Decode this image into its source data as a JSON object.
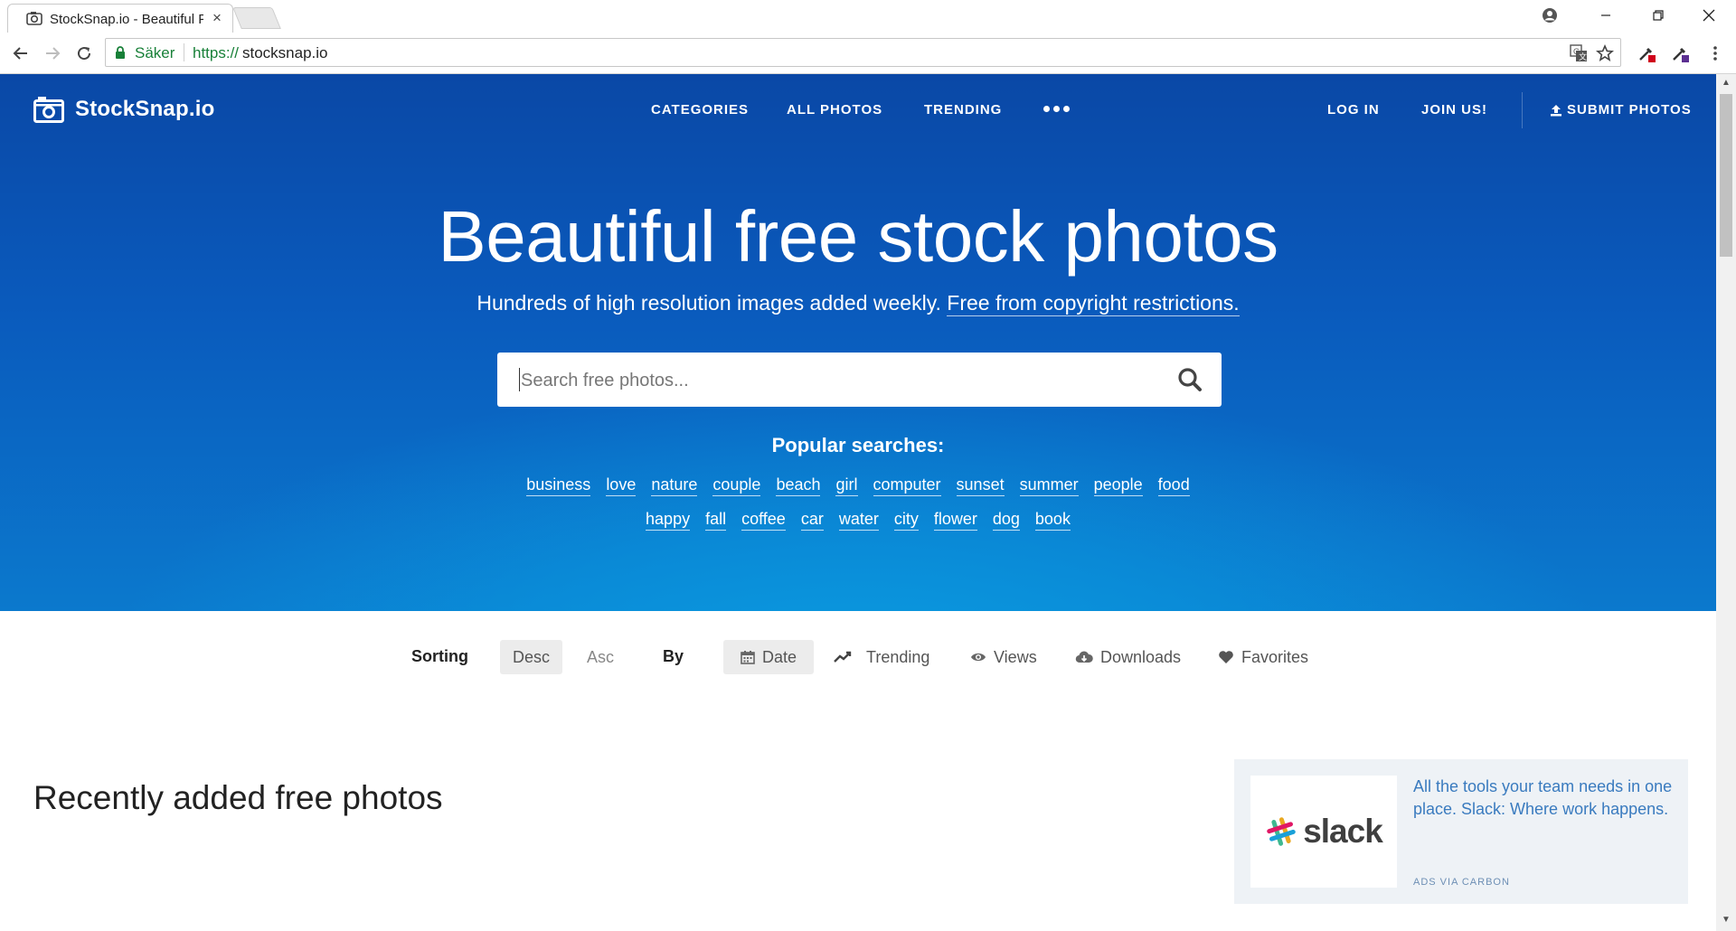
{
  "browser": {
    "tab_title": "StockSnap.io - Beautiful Free Stock Photos",
    "tab_close": "×",
    "secure_label": "Säker",
    "url_scheme": "https://",
    "url_host": "stocksnap.io"
  },
  "site": {
    "logo_text": "StockSnap.io",
    "nav": {
      "categories": "CATEGORIES",
      "all_photos": "ALL PHOTOS",
      "trending": "TRENDING",
      "log_in": "LOG IN",
      "join_us": "JOIN US!",
      "submit_photos": "SUBMIT PHOTOS"
    },
    "hero": {
      "title": "Beautiful free stock photos",
      "subtitle": "Hundreds of high resolution images added weekly.",
      "subtitle_link": "Free from copyright restrictions.",
      "search_placeholder": "Search free photos...",
      "popular_title": "Popular searches:",
      "popular_row1": [
        "business",
        "love",
        "nature",
        "couple",
        "beach",
        "girl",
        "computer",
        "sunset",
        "summer",
        "people",
        "food"
      ],
      "popular_row2": [
        "happy",
        "fall",
        "coffee",
        "car",
        "water",
        "city",
        "flower",
        "dog",
        "book"
      ]
    },
    "sorting": {
      "label": "Sorting",
      "desc": "Desc",
      "asc": "Asc",
      "by_label": "By",
      "date": "Date",
      "trending": "Trending",
      "views": "Views",
      "downloads": "Downloads",
      "favorites": "Favorites"
    },
    "recent_title": "Recently added free photos",
    "ad": {
      "logo_text": "slack",
      "text": "All the tools your team needs in one place. Slack: Where work happens.",
      "via": "ADS VIA CARBON"
    }
  },
  "colors": {
    "hero_top": "#0a48a6",
    "hero_bottom": "#0b79cd",
    "secure_green": "#188038",
    "ad_text": "#3a7bbf"
  }
}
